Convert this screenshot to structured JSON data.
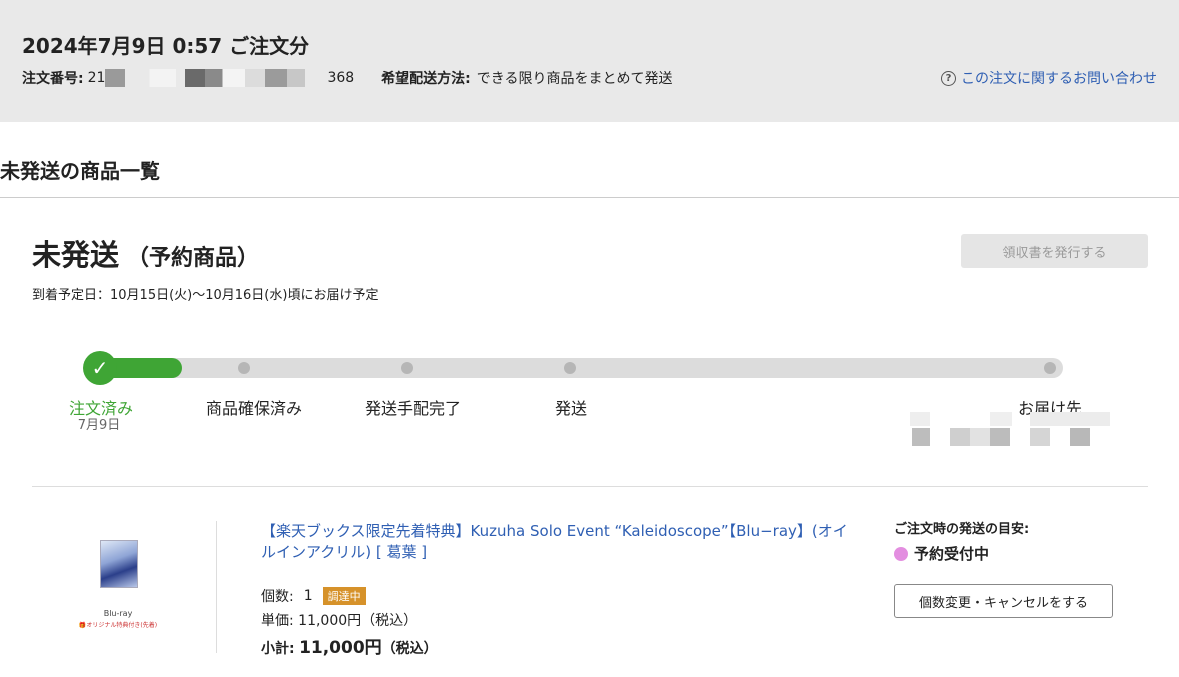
{
  "header": {
    "order_title": "2024年7月9日 0:57 ご注文分",
    "order_number_label": "注文番号:",
    "order_number_prefix": "21",
    "order_number_suffix": "368",
    "shipping_method_label": "希望配送方法:",
    "shipping_method_value": "できる限り商品をまとめて発送",
    "inquiry_link": "この注文に関するお問い合わせ",
    "inquiry_icon": "question-circle-icon"
  },
  "section": {
    "title": "未発送の商品一覧"
  },
  "status": {
    "title": "未発送",
    "subtitle": "（予約商品）",
    "receipt_button": "領収書を発行する",
    "arrival": "到着予定日：10月15日(火)〜10月16日(水)頃にお届け予定"
  },
  "progress": {
    "completed_fraction": 0.085,
    "steps": [
      {
        "label": "注文済み",
        "date": "7月9日",
        "done": true
      },
      {
        "label": "商品確保済み",
        "done": false
      },
      {
        "label": "発送手配完了",
        "done": false
      },
      {
        "label": "発送",
        "done": false
      },
      {
        "label": "お届け先",
        "done": false
      }
    ]
  },
  "item": {
    "thumb_label": "Blu-ray",
    "thumb_sub": "🎁オリジナル特典付き(先着)",
    "title": "【楽天ブックス限定先着特典】Kuzuha Solo Event “Kaleidoscope”【Blu−ray】(オイルインアクリル) [ 葛葉 ]",
    "quantity_label": "個数:",
    "quantity_value": "1",
    "badge": "調達中",
    "unit_price_label": "単価:",
    "unit_price_value": "11,000円（税込）",
    "subtotal_label": "小計:",
    "subtotal_value": "11,000円",
    "subtotal_tax": "（税込）"
  },
  "shipping_estimate": {
    "title": "ご注文時の発送の目安:",
    "status": "予約受付中",
    "cancel_button": "個数変更・キャンセルをする"
  },
  "colors": {
    "accent_green": "#3fa535",
    "link_blue": "#2f5fb3",
    "badge_orange": "#d6922a",
    "status_pink": "#e38ee0"
  }
}
